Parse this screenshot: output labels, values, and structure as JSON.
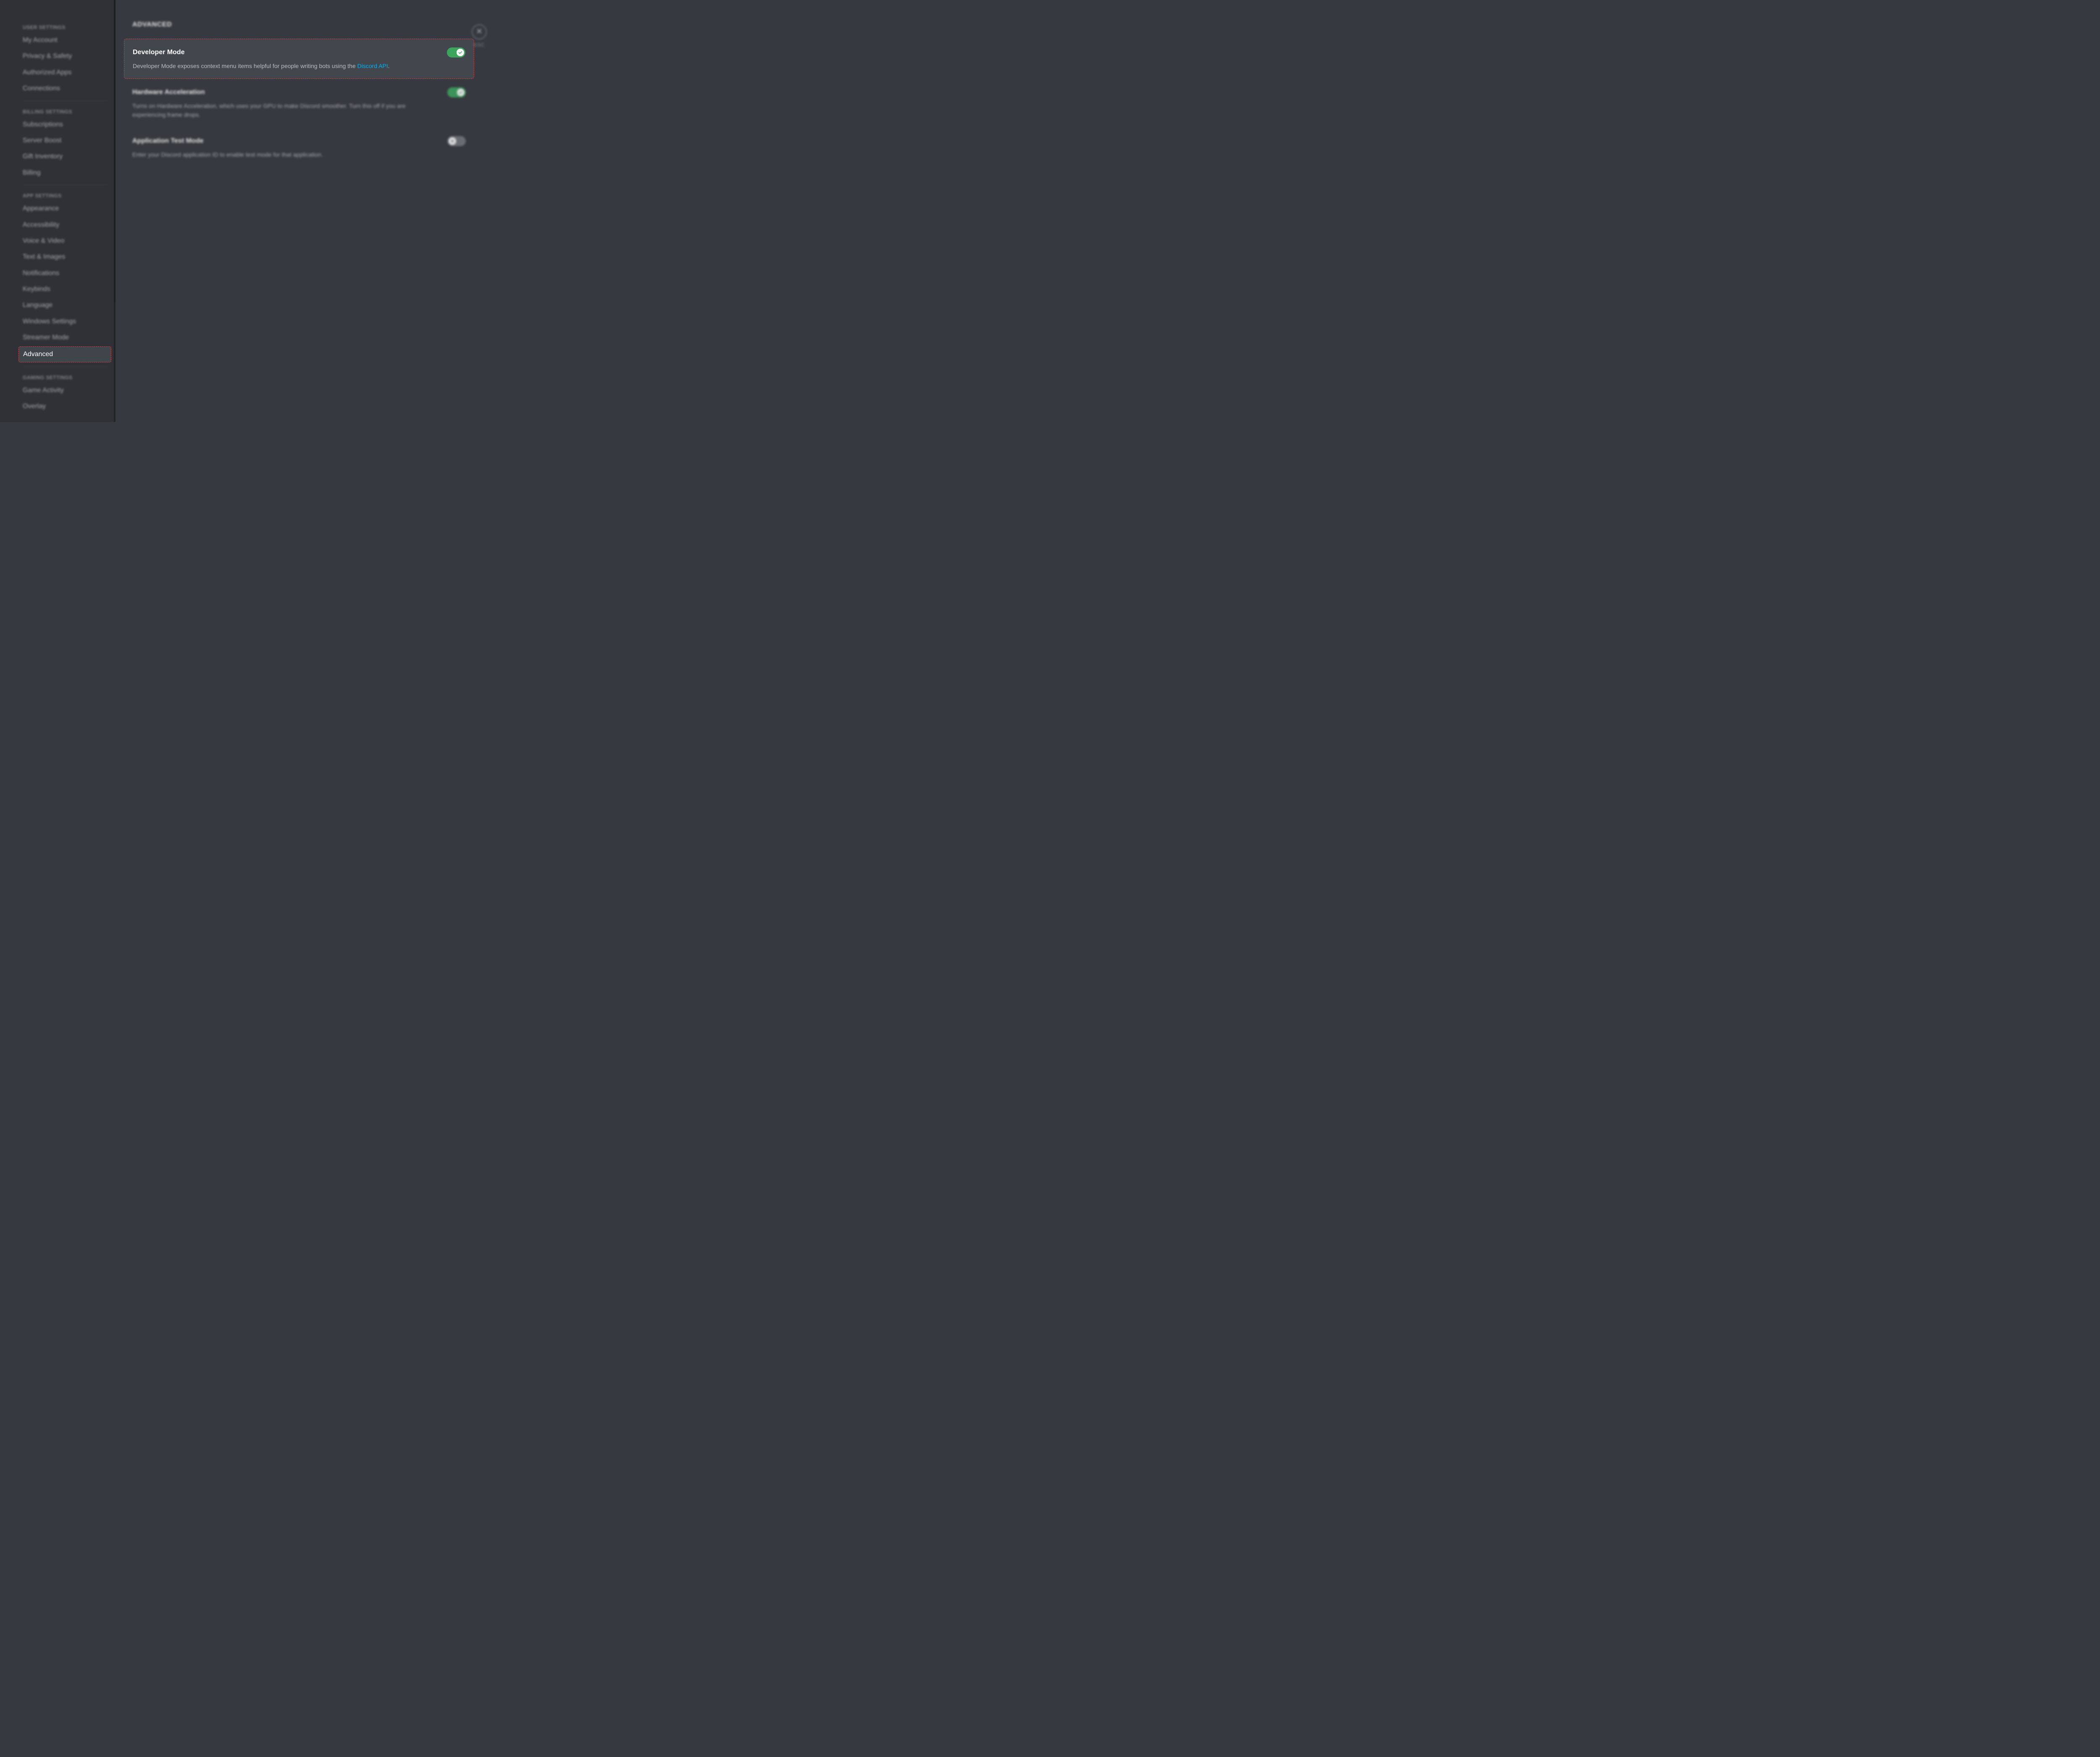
{
  "sidebar": {
    "sections": [
      {
        "header": "USER SETTINGS",
        "items": [
          {
            "label": "My Account"
          },
          {
            "label": "Privacy & Safety"
          },
          {
            "label": "Authorized Apps"
          },
          {
            "label": "Connections"
          }
        ]
      },
      {
        "header": "BILLING SETTINGS",
        "items": [
          {
            "label": "Subscriptions"
          },
          {
            "label": "Server Boost"
          },
          {
            "label": "Gift Inventory"
          },
          {
            "label": "Billing"
          }
        ]
      },
      {
        "header": "APP SETTINGS",
        "items": [
          {
            "label": "Appearance"
          },
          {
            "label": "Accessibility"
          },
          {
            "label": "Voice & Video"
          },
          {
            "label": "Text & Images"
          },
          {
            "label": "Notifications"
          },
          {
            "label": "Keybinds"
          },
          {
            "label": "Language"
          },
          {
            "label": "Windows Settings"
          },
          {
            "label": "Streamer Mode"
          },
          {
            "label": "Advanced",
            "active": true
          }
        ]
      },
      {
        "header": "GAMING SETTINGS",
        "items": [
          {
            "label": "Game Activity"
          },
          {
            "label": "Overlay"
          }
        ]
      }
    ]
  },
  "main": {
    "title": "ADVANCED",
    "settings": {
      "developer_mode": {
        "title": "Developer Mode",
        "description_prefix": "Developer Mode exposes context menu items helpful for people writing bots using the ",
        "link_text": "Discord API",
        "description_suffix": ".",
        "enabled": true
      },
      "hardware_acceleration": {
        "title": "Hardware Acceleration",
        "description": "Turns on Hardware Acceleration, which uses your GPU to make Discord smoother. Turn this off if you are experiencing frame drops.",
        "enabled": true
      },
      "application_test_mode": {
        "title": "Application Test Mode",
        "description": "Enter your Discord application ID to enable test mode for that application.",
        "enabled": false
      }
    },
    "close_label": "ESC"
  }
}
